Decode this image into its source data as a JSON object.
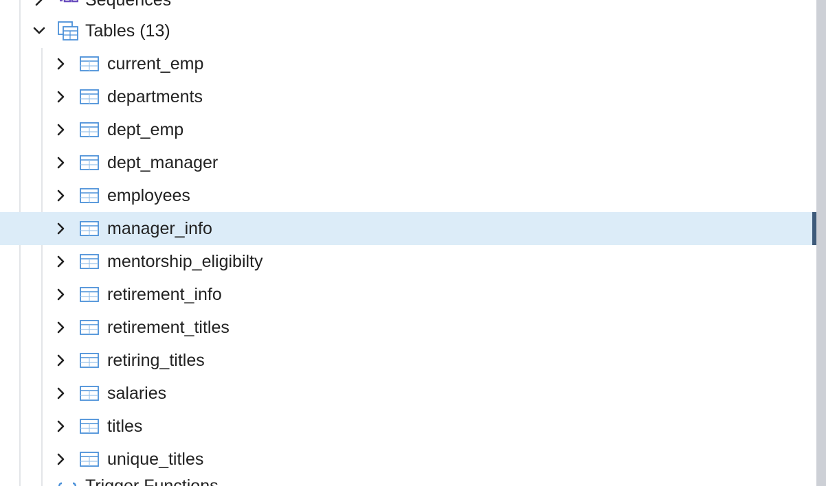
{
  "tree": {
    "partial_top_label": "Sequences",
    "group": {
      "label": "Tables (13)",
      "expanded": true,
      "icon": "tables-icon"
    },
    "tables": [
      {
        "label": "current_emp"
      },
      {
        "label": "departments"
      },
      {
        "label": "dept_emp"
      },
      {
        "label": "dept_manager"
      },
      {
        "label": "employees"
      },
      {
        "label": "manager_info"
      },
      {
        "label": "mentorship_eligibilty"
      },
      {
        "label": "retirement_info"
      },
      {
        "label": "retirement_titles"
      },
      {
        "label": "retiring_titles"
      },
      {
        "label": "salaries"
      },
      {
        "label": "titles"
      },
      {
        "label": "unique_titles"
      }
    ],
    "selected_index": 5,
    "partial_bottom_label": "Trigger Functions"
  },
  "colors": {
    "selected_bg": "#dcecf8",
    "selected_bar": "#3e5a7a",
    "icon_blue": "#4a90d9",
    "text": "#222222"
  }
}
